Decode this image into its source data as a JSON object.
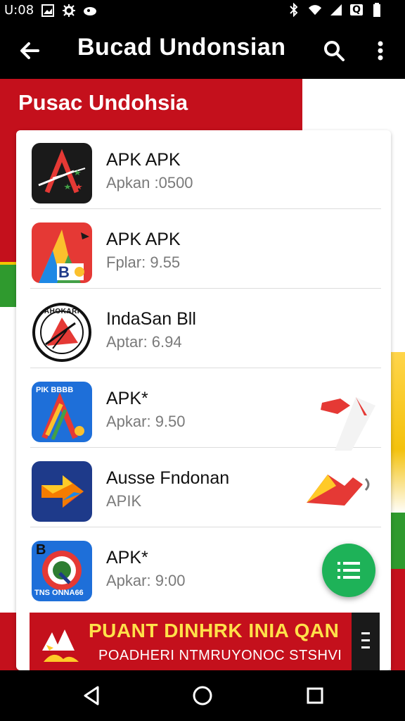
{
  "status_bar": {
    "time": "U:08",
    "battery": "Q"
  },
  "toolbar": {
    "title": "Bucad Undonsian"
  },
  "section": {
    "title": "Pusac Undohsia"
  },
  "apps": [
    {
      "name": "APK APK",
      "subtitle": "Apkan :0500"
    },
    {
      "name": "APK APK",
      "subtitle": "Fplar: 9.55"
    },
    {
      "name": "IndaSan Bll",
      "subtitle": "Aptar: 6.94"
    },
    {
      "name": "APK*",
      "subtitle": "Apkar: 9.50"
    },
    {
      "name": "Ausse Fndonan",
      "subtitle": "APIK"
    },
    {
      "name": "APK*",
      "subtitle": "Apkar: 9:00"
    }
  ],
  "banner": {
    "headline": "PUANT DINHRK INIA QAN",
    "subline": "POADHERI NTMRUYONOC STSHVI"
  },
  "icon_texts": {
    "app3_ring": "AHOKARI",
    "app4_top": "PIK BBBB",
    "app6_top": "B",
    "app6_bottom": "TNS ONNA66"
  },
  "colors": {
    "accent_red": "#c4101c",
    "fab_green": "#1eb258",
    "toolbar_black": "#000000",
    "banner_yellow": "#ffe14a"
  },
  "icons": {
    "back": "arrow-left-icon",
    "search": "search-icon",
    "more": "more-vert-icon",
    "fab": "list-icon"
  }
}
